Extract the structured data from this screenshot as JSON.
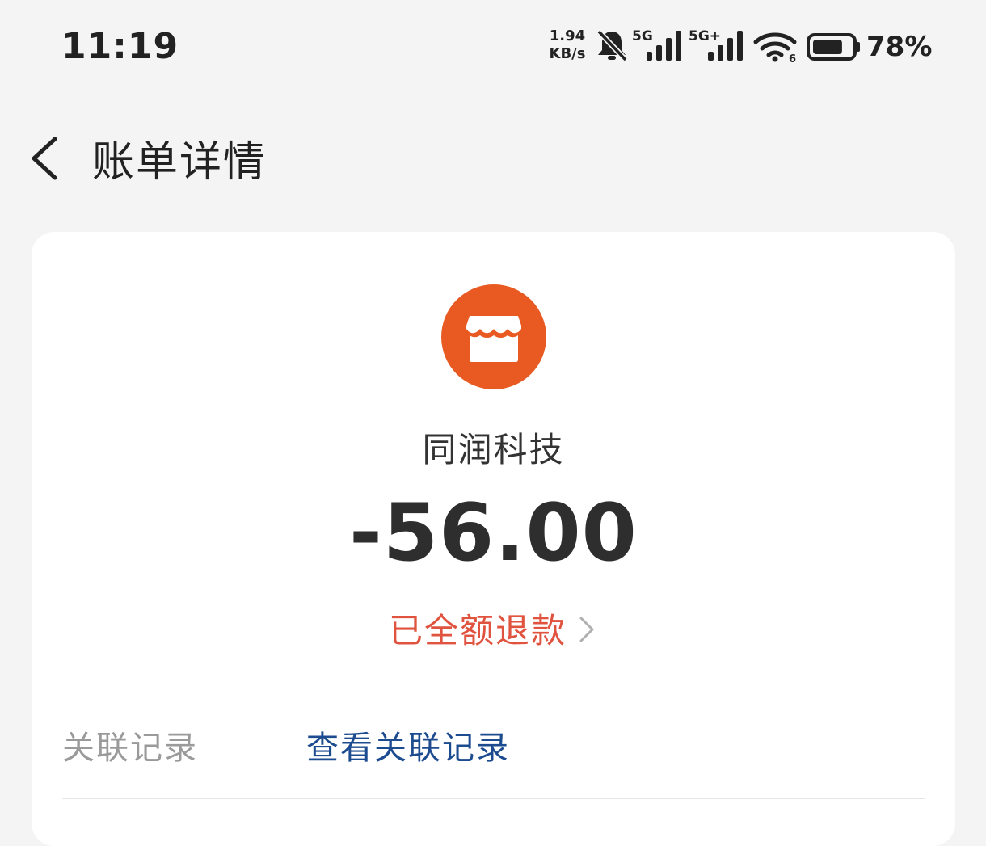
{
  "status_bar": {
    "time": "11:19",
    "net_speed_value": "1.94",
    "net_speed_unit": "KB/s",
    "sim1_network": "5G",
    "sim2_network": "5G+",
    "wifi_label": "6",
    "battery_percent": "78%",
    "battery_level": 0.78,
    "icons": [
      "bell-muted-icon",
      "signal-icon",
      "signal-icon",
      "wifi-icon",
      "battery-icon"
    ]
  },
  "header": {
    "title": "账单详情",
    "back_icon": "chevron-left-icon"
  },
  "bill": {
    "merchant_icon": "store-icon",
    "merchant_name": "同润科技",
    "amount": "-56.00",
    "refund_status": "已全额退款",
    "refund_chevron": "chevron-right-icon"
  },
  "details": [
    {
      "label": "关联记录",
      "value": "查看关联记录"
    }
  ],
  "colors": {
    "background": "#f4f4f4",
    "card": "#ffffff",
    "merchant_logo": "#e85a22",
    "refund_text": "#e0533f",
    "link": "#1d4b8f",
    "label": "#9a9a9a"
  }
}
